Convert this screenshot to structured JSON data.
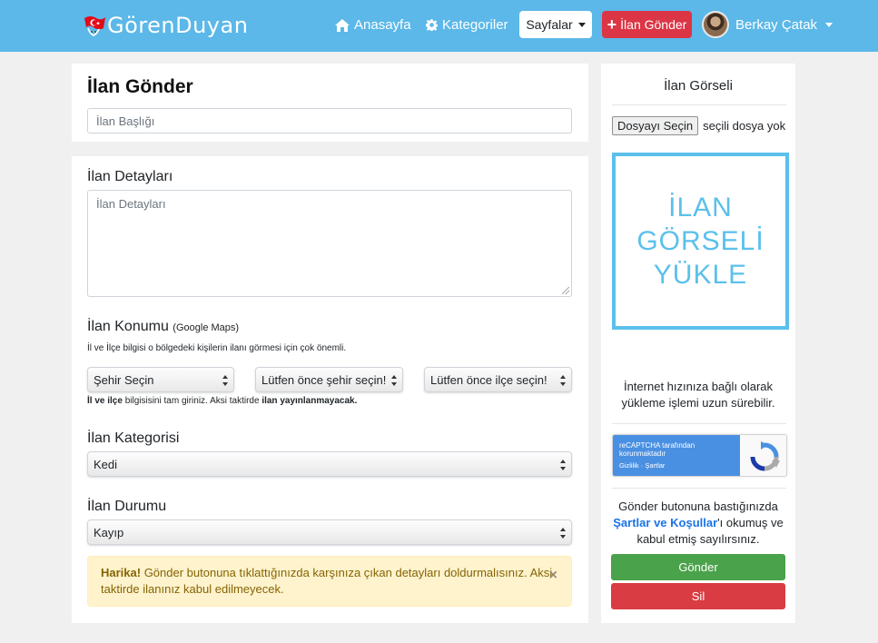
{
  "brand": {
    "name": "GörenDuyan"
  },
  "nav": {
    "home": "Anasayfa",
    "categories": "Kategoriler",
    "pages": "Sayfalar",
    "post_ad": "İlan Gönder",
    "user": "Berkay Çatak"
  },
  "form": {
    "page_title": "İlan Gönder",
    "title_placeholder": "İlan Başlığı",
    "details_heading": "İlan Detayları",
    "details_placeholder": "İlan Detayları",
    "location_heading": "İlan Konumu",
    "location_note": "(Google Maps)",
    "location_hint": "İl ve İlçe bilgisi o bölgedeki kişilerin ilanı görmesi için çok önemli.",
    "city_select": "Şehir Seçin",
    "district_select": "Lütfen önce şehir seçin!",
    "neighborhood_select": "Lütfen önce ilçe seçin!",
    "warning_bold1": "İl ve ilçe",
    "warning_mid": " bilgisisini tam giriniz. Aksi taktirde ",
    "warning_bold2": "ilan yayınlanmayacak.",
    "category_heading": "İlan Kategorisi",
    "category_value": "Kedi",
    "status_heading": "İlan Durumu",
    "status_value": "Kayıp",
    "alert_strong": "Harika!",
    "alert_text": " Gönder butonuna tıklattığınızda karşınıza çıkan detayları doldurmalısınız. Aksi taktirde ilanınız kabul edilmeyecek."
  },
  "sidebar": {
    "title": "İlan Görseli",
    "file_button": "Dosyayı Seçin",
    "file_status": "seçili dosya yok",
    "upload_line1": "İLAN",
    "upload_line2": "GÖRSELİ",
    "upload_line3": "YÜKLE",
    "speed_note": "İnternet hızınıza bağlı olarak yükleme işlemi uzun sürebilir.",
    "recaptcha_line1": "reCAPTCHA tarafından",
    "recaptcha_line2": "korunmaktadır",
    "recaptcha_links": "Gizlilik · Şartlar",
    "terms_pre": "Gönder butonuna bastığınızda ",
    "terms_link": "Şartlar ve Koşullar",
    "terms_post": "'ı okumuş ve kabul etmiş sayılırsınız.",
    "send_button": "Gönder",
    "delete_button": "Sil"
  },
  "colors": {
    "navbar": "#5bb8e8",
    "danger": "#dc3545",
    "success": "#4aa24a",
    "upload_accent": "#5bc0eb"
  },
  "icons": [
    "home-icon",
    "cog-icon",
    "plus-icon",
    "caret-down-icon",
    "close-icon",
    "recaptcha-icon"
  ]
}
